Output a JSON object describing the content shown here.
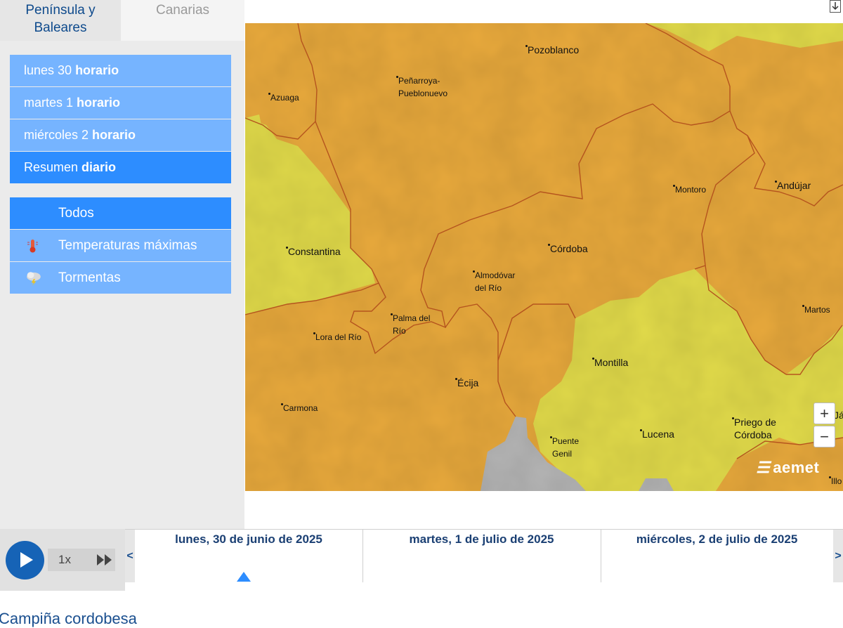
{
  "region_tabs": [
    {
      "label": "Península y Baleares",
      "line1": "Península y",
      "line2": "Baleares",
      "active": true
    },
    {
      "label": "Canarias",
      "active": false
    }
  ],
  "day_buttons": [
    {
      "day": "lunes 30",
      "mode": "horario",
      "active": false
    },
    {
      "day": "martes 1",
      "mode": "horario",
      "active": false
    },
    {
      "day": "miércoles 2",
      "mode": "horario",
      "active": false
    },
    {
      "day": "Resumen",
      "mode": "diario",
      "active": true
    }
  ],
  "filters": [
    {
      "label": "Todos",
      "icon": "none",
      "active": true
    },
    {
      "label": "Temperaturas máximas",
      "icon": "thermometer-icon",
      "active": false
    },
    {
      "label": "Tormentas",
      "icon": "storm-cloud-icon",
      "active": false
    }
  ],
  "map": {
    "warning_colors": {
      "orange": "#e8a93c",
      "yellow": "#e2db4a",
      "no_warning": "#b4b4b4"
    },
    "places": [
      {
        "name": "Pozoblanco",
        "line2": ""
      },
      {
        "name": "Peñarroya-",
        "line2": "Pueblonuevo"
      },
      {
        "name": "Azuaga",
        "line2": ""
      },
      {
        "name": "Andújar",
        "line2": ""
      },
      {
        "name": "Montoro",
        "line2": ""
      },
      {
        "name": "Constantina",
        "line2": ""
      },
      {
        "name": "Córdoba",
        "line2": ""
      },
      {
        "name": "Almodóvar",
        "line2": "del Río"
      },
      {
        "name": "Martos",
        "line2": ""
      },
      {
        "name": "Palma del",
        "line2": "Río"
      },
      {
        "name": "Lora del Río",
        "line2": ""
      },
      {
        "name": "Montilla",
        "line2": ""
      },
      {
        "name": "Écija",
        "line2": ""
      },
      {
        "name": "Carmona",
        "line2": ""
      },
      {
        "name": "Priego de",
        "line2": "Córdoba"
      },
      {
        "name": "Lucena",
        "line2": ""
      },
      {
        "name": "Puente",
        "line2": "Genil"
      },
      {
        "name": "Illo",
        "line2": ""
      },
      {
        "name": "Já",
        "line2": ""
      }
    ],
    "zoom_in": "+",
    "zoom_out": "−",
    "logo": "aemet"
  },
  "player": {
    "speed": "1x"
  },
  "timeline": {
    "days": [
      "lunes, 30 de junio de 2025",
      "martes, 1 de julio de 2025",
      "miércoles, 2 de julio de 2025"
    ],
    "prev": "<",
    "next": ">"
  },
  "zone_title": "Campiña cordobesa"
}
